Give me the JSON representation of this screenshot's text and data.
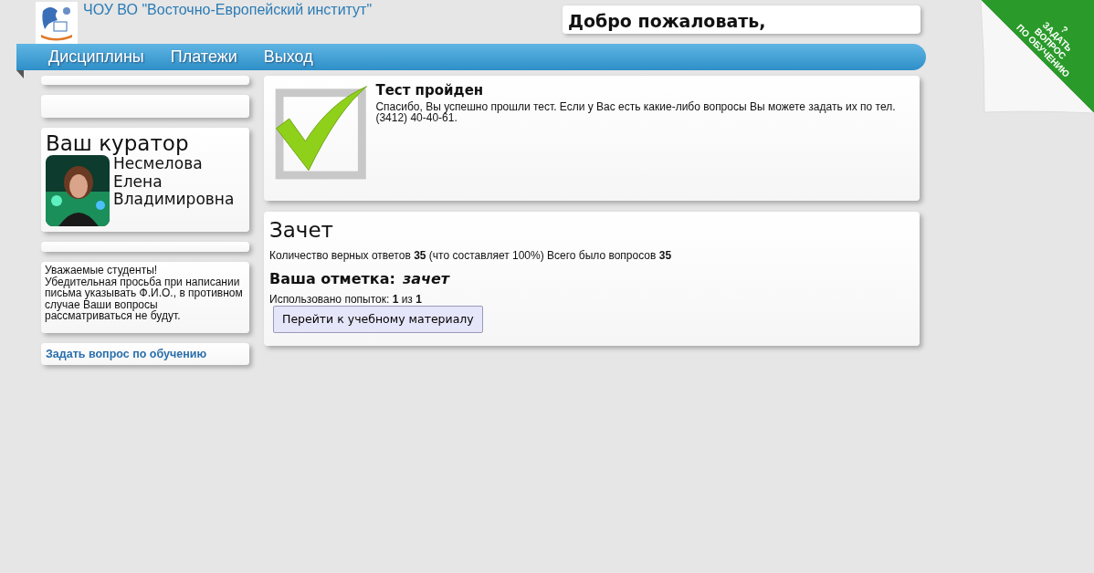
{
  "header": {
    "title": "ЧОУ ВО \"Восточно-Европейский институт\"",
    "welcome": "Добро пожаловать,"
  },
  "nav": [
    {
      "label": "Дисциплины"
    },
    {
      "label": "Платежи"
    },
    {
      "label": "Выход"
    }
  ],
  "corner_ribbon": {
    "mark": "?",
    "lines": [
      "ЗАДАТЬ",
      "ВОПРОС",
      "ПО ОБУЧЕНИЮ"
    ]
  },
  "sidebar": {
    "curator": {
      "heading": "Ваш куратор",
      "name_lines": [
        "Несмелова",
        "Елена",
        "Владимировна"
      ]
    },
    "notice": [
      "Уважаемые студенты!",
      "Убедительная просьба при написании письма указывать Ф.И.О., в противном случае Ваши вопросы рассматриваться не будут."
    ],
    "link": "Задать вопрос по обучению"
  },
  "result": {
    "title": "Тест пройден",
    "message": "Спасибо, Вы успешно прошли тест. Если у Вас есть какие-либо вопросы Вы можете задать их по тел. (3412) 40-40-61."
  },
  "grade": {
    "title": "Зачет",
    "summary": "Количество верных ответов **35** (что составляет 100%) Всего было вопросов **35**",
    "mark_label": "Ваша отметка:",
    "mark_value": "зачет",
    "attempts": "Использовано попыток: **1** из **1**",
    "button": "Перейти к учебному материалу"
  }
}
